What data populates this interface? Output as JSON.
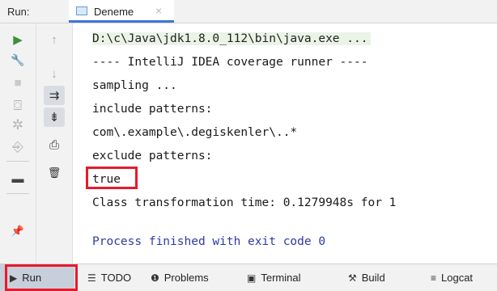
{
  "header": {
    "run_label": "Run:",
    "tab_title": "Deneme",
    "tab_close": "×"
  },
  "toolbar_left": {
    "items": [
      {
        "name": "rerun-icon",
        "glyph": "▶"
      },
      {
        "name": "wrench-icon",
        "glyph": "🔧"
      },
      {
        "name": "stop-icon",
        "glyph": "■"
      },
      {
        "name": "camera-icon",
        "glyph": "⌼"
      },
      {
        "name": "bug-icon",
        "glyph": "✲"
      },
      {
        "name": "login-icon",
        "glyph": "⎆"
      },
      {
        "name": "layout-icon",
        "glyph": "▬"
      },
      {
        "name": "pin-icon",
        "glyph": "📌"
      }
    ]
  },
  "toolbar_right": {
    "items": [
      {
        "name": "up-arrow-icon",
        "glyph": "↑"
      },
      {
        "name": "down-arrow-icon",
        "glyph": "↓"
      },
      {
        "name": "soft-wrap-icon",
        "glyph": "⇉"
      },
      {
        "name": "scroll-to-end-icon",
        "glyph": "⇟"
      },
      {
        "name": "print-icon",
        "glyph": "⎙"
      },
      {
        "name": "trash-icon",
        "glyph": "🗑"
      }
    ]
  },
  "console": {
    "lines": [
      "D:\\c\\Java\\jdk1.8.0_112\\bin\\java.exe ...",
      "---- IntelliJ IDEA coverage runner ----",
      "sampling ...",
      "include patterns:",
      "com\\.example\\.degiskenler\\..*",
      "exclude patterns:",
      "true",
      "Class transformation time: 0.1279948s for 1",
      "",
      "Process finished with exit code 0"
    ]
  },
  "bottom_tabs": [
    {
      "name": "run",
      "icon": "▶",
      "label": "Run"
    },
    {
      "name": "todo",
      "icon": "☰",
      "label": "TODO"
    },
    {
      "name": "problems",
      "icon": "❶",
      "label": "Problems"
    },
    {
      "name": "terminal",
      "icon": "▣",
      "label": "Terminal"
    },
    {
      "name": "build",
      "icon": "⚒",
      "label": "Build"
    },
    {
      "name": "logcat",
      "icon": "≡",
      "label": "Logcat"
    }
  ],
  "colors": {
    "highlight_red": "#e8192c",
    "exit_text_blue": "#2d3aa8",
    "tab_underline_blue": "#3f75d9"
  }
}
